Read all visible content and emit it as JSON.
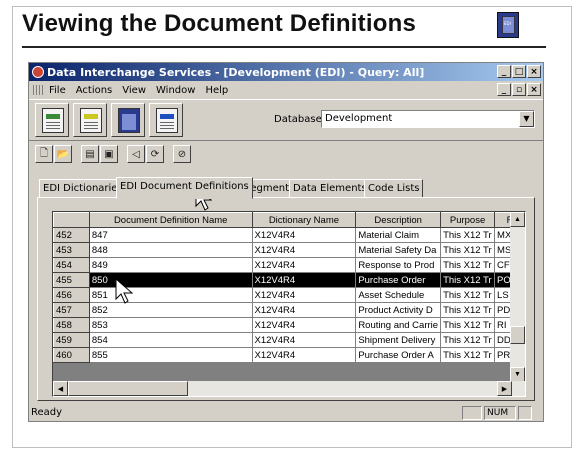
{
  "slide": {
    "title": "Viewing the Document Definitions",
    "icon_label": "EDI"
  },
  "window": {
    "title": "Data Interchange Services - [Development (EDI) - Query: All]",
    "menu": [
      "File",
      "Actions",
      "View",
      "Window",
      "Help"
    ],
    "database_label": "Database",
    "database_value": "Development",
    "tabs": [
      "EDI Dictionaries",
      "EDI Document Definitions",
      "Segments",
      "Data Elements",
      "Code Lists"
    ],
    "active_tab": "EDI Document Definitions",
    "status_text": "Ready",
    "status_num": "NUM"
  },
  "grid": {
    "columns": [
      "",
      "Document Definition Name",
      "Dictionary Name",
      "Description",
      "Purpose",
      "F"
    ],
    "rows": [
      {
        "id": "452",
        "name": "847",
        "dict": "X12V4R4",
        "desc": "Material Claim",
        "purpose": "This X12 Tr",
        "f": "MX"
      },
      {
        "id": "453",
        "name": "848",
        "dict": "X12V4R4",
        "desc": "Material Safety Da",
        "purpose": "This X12 Tr",
        "f": "MS"
      },
      {
        "id": "454",
        "name": "849",
        "dict": "X12V4R4",
        "desc": "Response to Prod",
        "purpose": "This X12 Tr",
        "f": "CF"
      },
      {
        "id": "455",
        "name": "850",
        "dict": "X12V4R4",
        "desc": "Purchase Order",
        "purpose": "This X12 Tr",
        "f": "PO"
      },
      {
        "id": "456",
        "name": "851",
        "dict": "X12V4R4",
        "desc": "Asset Schedule",
        "purpose": "This X12 Tr",
        "f": "LS"
      },
      {
        "id": "457",
        "name": "852",
        "dict": "X12V4R4",
        "desc": "Product Activity D",
        "purpose": "This X12 Tr",
        "f": "PD"
      },
      {
        "id": "458",
        "name": "853",
        "dict": "X12V4R4",
        "desc": "Routing and Carrie",
        "purpose": "This X12 Tr",
        "f": "RI"
      },
      {
        "id": "459",
        "name": "854",
        "dict": "X12V4R4",
        "desc": "Shipment Delivery",
        "purpose": "This X12 Tr",
        "f": "DD"
      },
      {
        "id": "460",
        "name": "855",
        "dict": "X12V4R4",
        "desc": "Purchase Order A",
        "purpose": "This X12 Tr",
        "f": "PR"
      }
    ],
    "selected_row": "455"
  }
}
